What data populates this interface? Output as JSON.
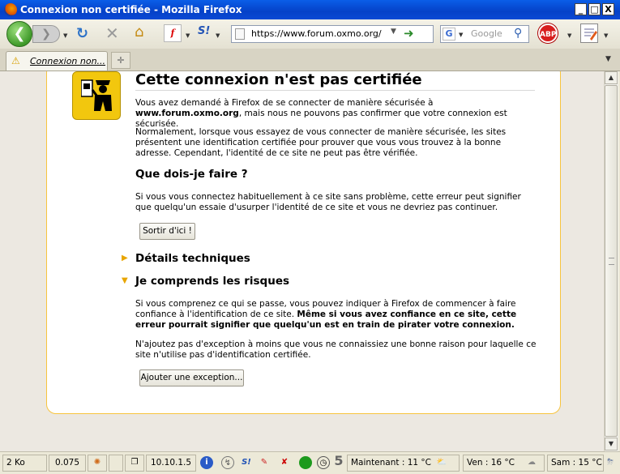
{
  "window": {
    "title": "Connexion non certifiée - Mozilla Firefox",
    "buttons": {
      "minimize": "_",
      "maximize": "□",
      "close": "X"
    }
  },
  "toolbar": {
    "back_icon": "back-arrow-icon",
    "forward_icon": "forward-arrow-icon",
    "url": "https://www.forum.oxmo.org/",
    "search_engine": "G",
    "search_placeholder": "Google",
    "flash_label": "f",
    "sifr_label": "S!",
    "adblock_label": "ABP"
  },
  "tabs": [
    {
      "label": "Connexion non...",
      "active": true
    }
  ],
  "page": {
    "title": "Cette connexion n'est pas certifiée",
    "intro_prefix": "Vous avez demandé à Firefox de se connecter de manière sécurisée à ",
    "intro_host": "www.forum.oxmo.org",
    "intro_suffix": ", mais nous ne pouvons pas confirmer que votre connexion est sécurisée.",
    "normal_text": "Normalement, lorsque vous essayez de vous connecter de manière sécurisée, les sites présentent une identification certifiée pour prouver que vous vous trouvez à la bonne adresse. Cependant, l'identité de ce site ne peut pas être vérifiée.",
    "what_title": "Que dois-je faire ?",
    "what_text": "Si vous vous connectez habituellement à ce site sans problème, cette erreur peut signifier que quelqu'un essaie d'usurper l'identité de ce site et vous ne devriez pas continuer.",
    "leave_button": "Sortir d'ici !",
    "technical_title": "Détails techniques",
    "risks_title": "Je comprends les risques",
    "risks_text_plain": "Si vous comprenez ce qui se passe, vous pouvez indiquer à Firefox de commencer à faire confiance à l'identification de ce site. ",
    "risks_text_bold": "Même si vous avez confiance en ce site, cette erreur pourrait signifier que quelqu'un est en train de pirater votre connexion.",
    "exception_text": "N'ajoutez pas d'exception à moins que vous ne connaissiez une bonne raison pour laquelle ce site n'utilise pas d'identification certifiée.",
    "exception_button": "Ajouter une exception..."
  },
  "statusbar": {
    "size": "2 Ko",
    "time": "0.075",
    "ip": "10.10.1.5",
    "counter": "5",
    "weather_now": "Maintenant : 11 °C",
    "weather_fri": "Ven : 16 °C",
    "weather_sat": "Sam : 15 °C"
  },
  "colors": {
    "titlebar": "#0a5ee8",
    "box_border": "#f7c43e",
    "badge": "#f2c70e",
    "arrow": "#e8a500"
  }
}
